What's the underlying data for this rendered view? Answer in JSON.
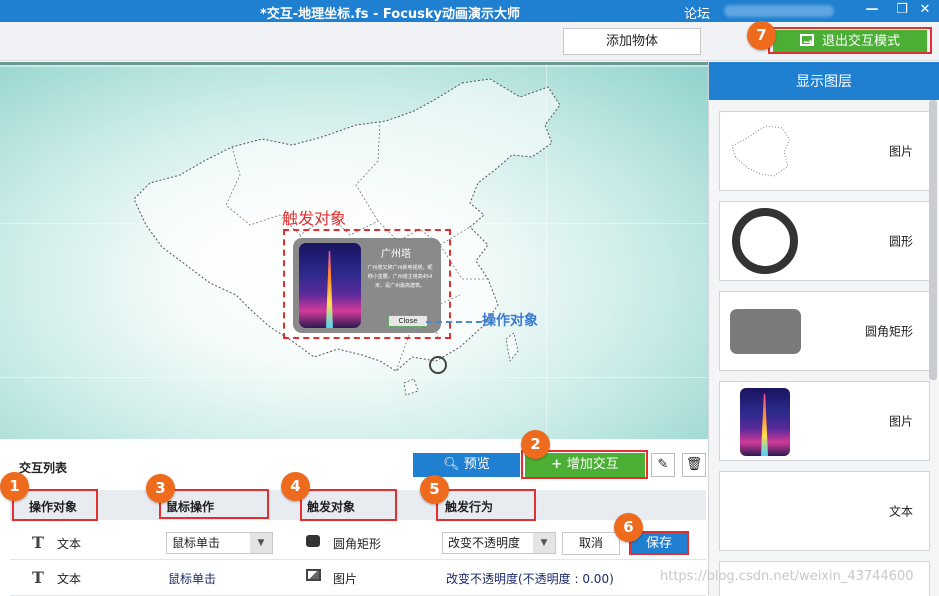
{
  "window": {
    "title": "*交互-地理坐标.fs - Focusky动画演示大师",
    "forum": "论坛",
    "min": "—",
    "restore": "❐",
    "close": "✕"
  },
  "toolbar": {
    "add_object": "添加物体",
    "exit_interaction": "退出交互模式"
  },
  "canvas": {
    "trigger_label": "触发对象",
    "operate_label": "操作对象",
    "popup": {
      "title": "广州塔",
      "text": "广州塔又称广州新电视塔，昵称小蛮腰，广州塔主塔高454米，是广州最高建筑。",
      "close": "Close"
    }
  },
  "layers": {
    "header": "显示图层",
    "items": [
      {
        "label": "图片",
        "thumb": "map-image"
      },
      {
        "label": "圆形",
        "thumb": "circle"
      },
      {
        "label": "圆角矩形",
        "thumb": "rounded-rect"
      },
      {
        "label": "图片",
        "thumb": "tower-photo"
      },
      {
        "label": "文本",
        "thumb": "text"
      }
    ]
  },
  "interaction_list": {
    "title": "交互列表",
    "preview": "预览",
    "add": "增加交互",
    "columns": [
      "操作对象",
      "鼠标操作",
      "触发对象",
      "触发行为"
    ],
    "rows": [
      {
        "target": "文本",
        "mouse": "鼠标单击",
        "trigger": "圆角矩形",
        "behavior": "改变不透明度",
        "editing": true
      },
      {
        "target": "文本",
        "mouse": "鼠标单击",
        "trigger": "图片",
        "behavior": "改变不透明度(不透明度 : 0.00)",
        "editing": false
      }
    ],
    "cancel": "取消",
    "save": "保存"
  },
  "badges": [
    "1",
    "2",
    "3",
    "4",
    "5",
    "6",
    "7"
  ],
  "watermark": "https://blog.csdn.net/weixin_43744600",
  "colors": {
    "primary_blue": "#1f7fd0",
    "green": "#4caf35",
    "badge_orange": "#ee6a1c",
    "highlight_red": "#e23030"
  }
}
